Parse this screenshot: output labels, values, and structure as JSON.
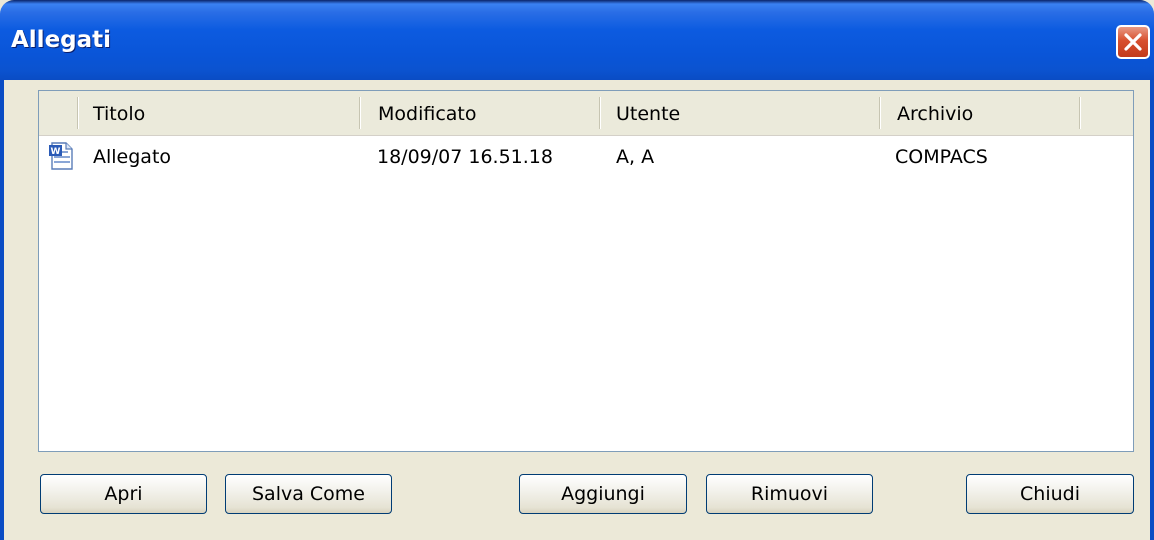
{
  "window": {
    "title": "Allegati"
  },
  "list": {
    "columns": [
      "Titolo",
      "Modificato",
      "Utente",
      "Archivio"
    ],
    "rows": [
      {
        "icon": "word-document-icon",
        "titolo": "Allegato",
        "modificato": "18/09/07 16.51.18",
        "utente": "A, A",
        "archivio": "COMPACS"
      }
    ]
  },
  "buttons": {
    "apri": "Apri",
    "salva_come": "Salva Come",
    "aggiungi": "Aggiungi",
    "rimuovi": "Rimuovi",
    "chiudi": "Chiudi"
  },
  "colors": {
    "titlebar": "#0a55d8",
    "close": "#d8502e",
    "dialog_bg": "#ece9d8"
  }
}
